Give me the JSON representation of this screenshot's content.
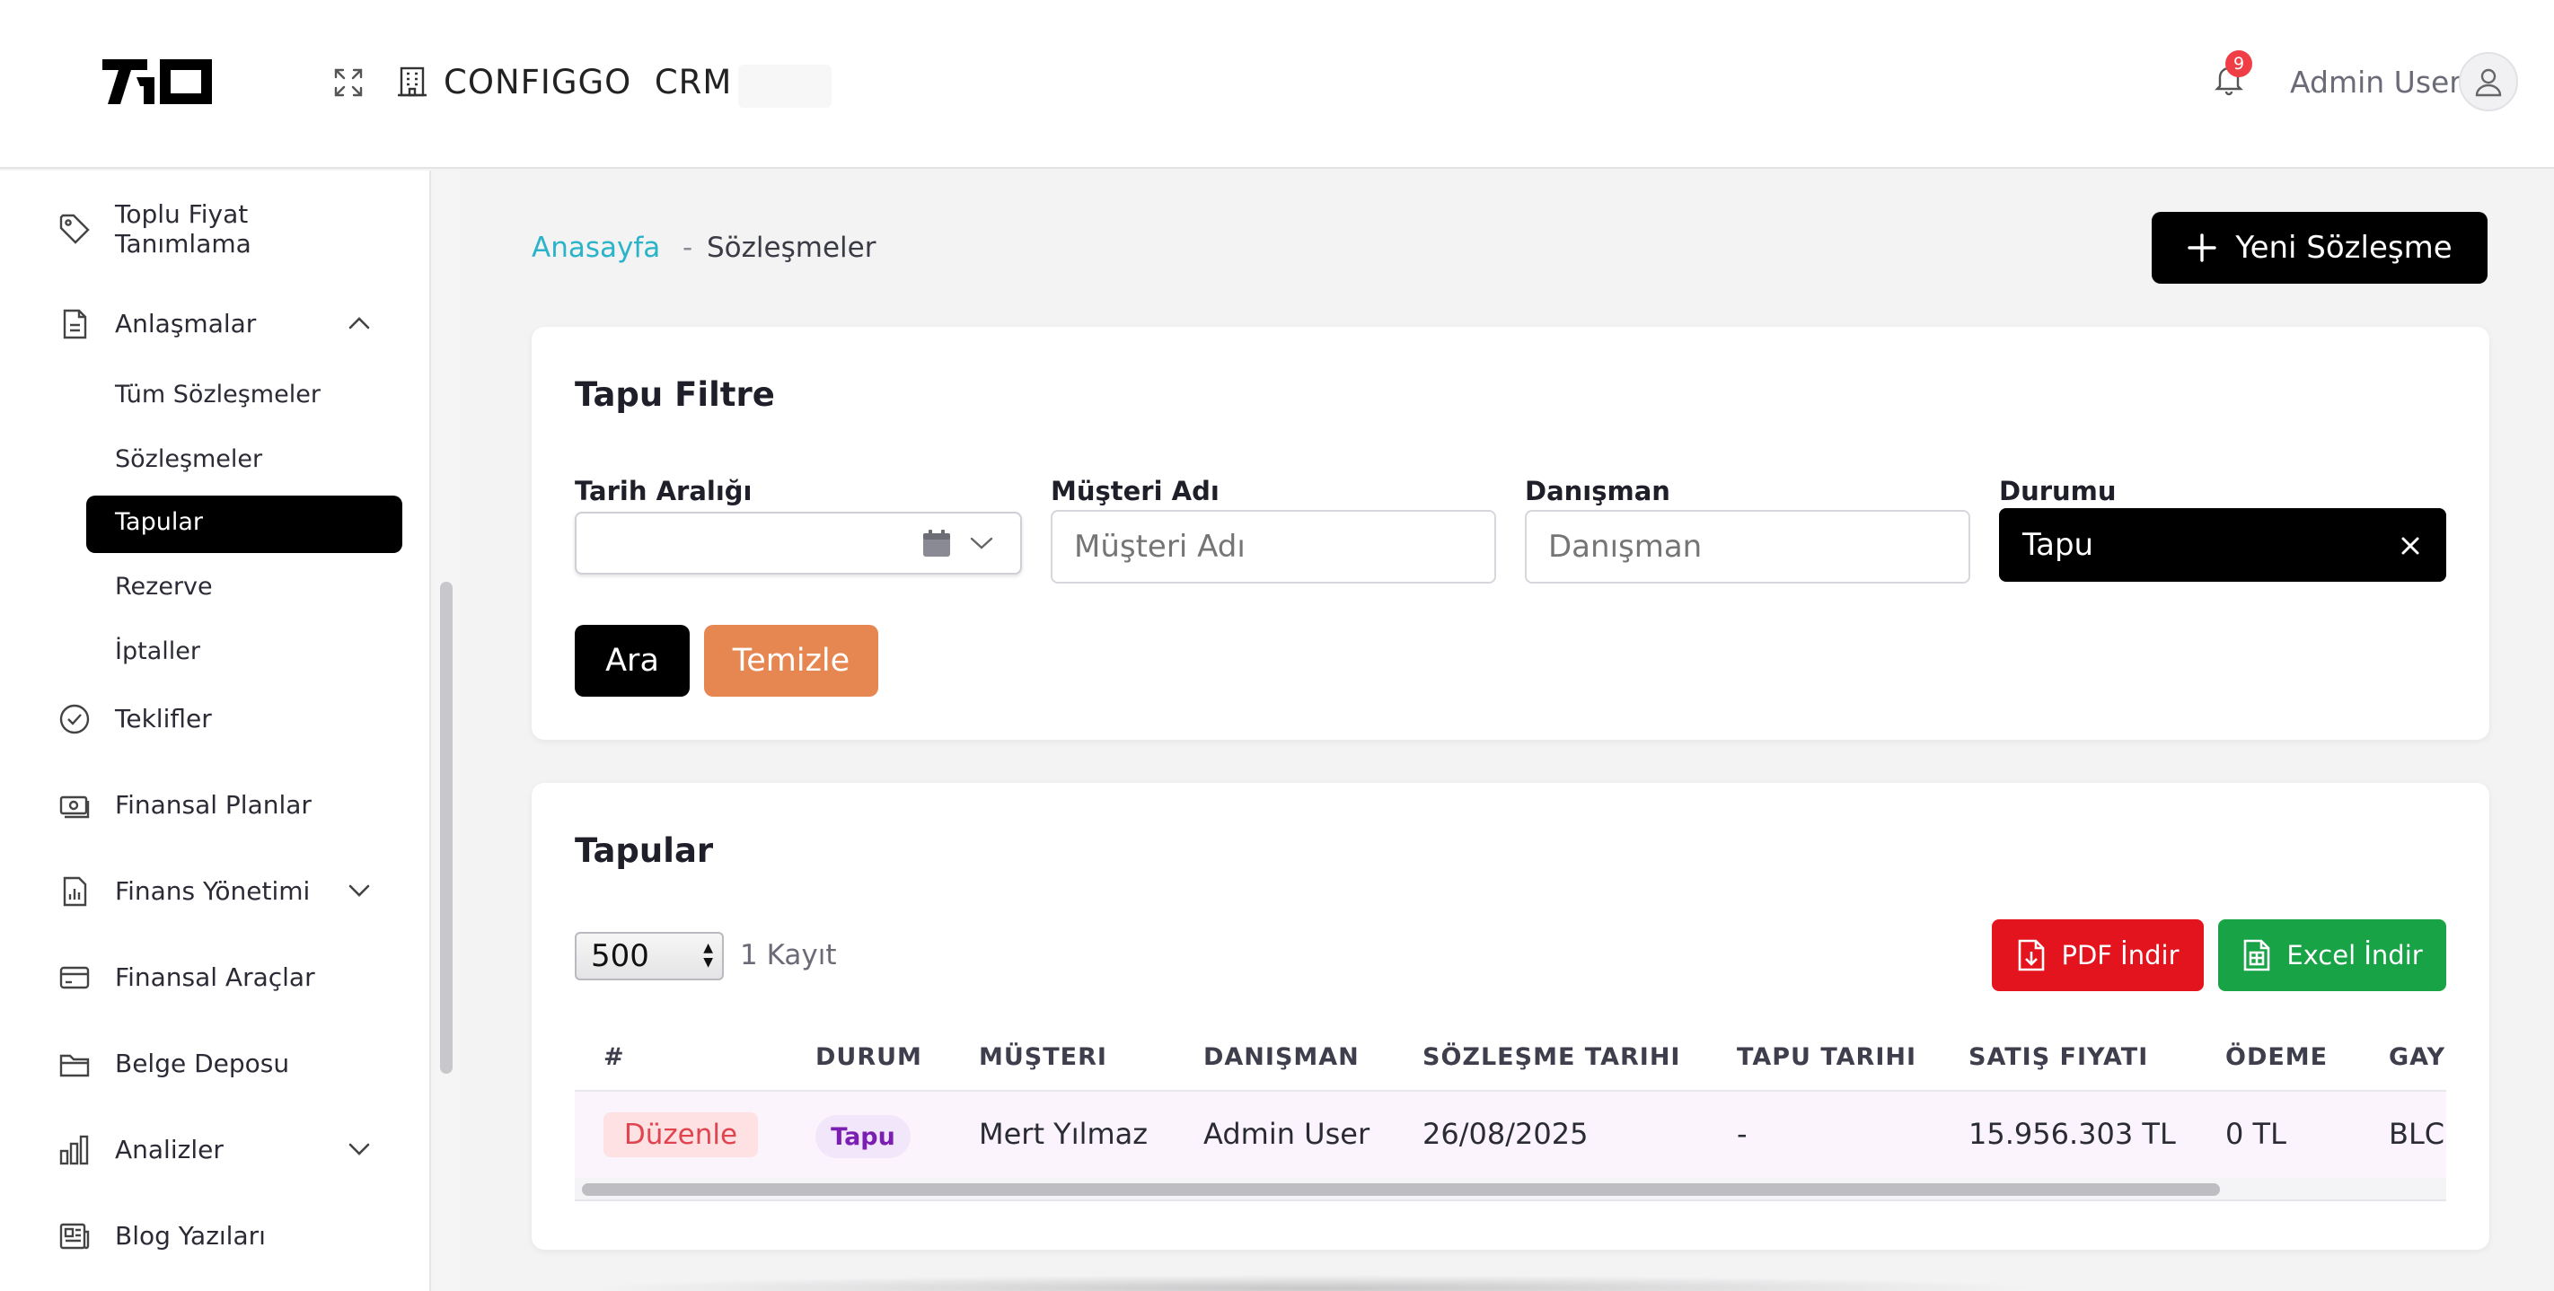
{
  "header": {
    "app_title": "CONFIGGO  CRM",
    "notification_count": "9",
    "user_name": "Admin User"
  },
  "sidebar": {
    "items": [
      {
        "label": "Toplu Fiyat\nTanımlama",
        "icon": "tag-icon"
      },
      {
        "label": "Anlaşmalar",
        "icon": "document-icon",
        "expanded": true
      },
      {
        "label": "Teklifler",
        "icon": "check-circle-icon"
      },
      {
        "label": "Finansal Planlar",
        "icon": "money-icon"
      },
      {
        "label": "Finans Yönetimi",
        "icon": "report-icon",
        "expandable": true
      },
      {
        "label": "Finansal Araçlar",
        "icon": "card-icon"
      },
      {
        "label": "Belge Deposu",
        "icon": "folder-icon"
      },
      {
        "label": "Analizler",
        "icon": "bar-chart-icon",
        "expandable": true
      },
      {
        "label": "Blog Yazıları",
        "icon": "newspaper-icon"
      }
    ],
    "sub_items": [
      {
        "label": "Tüm Sözleşmeler"
      },
      {
        "label": "Sözleşmeler"
      },
      {
        "label": "Tapular",
        "active": true
      },
      {
        "label": "Rezerve"
      },
      {
        "label": "İptaller"
      }
    ]
  },
  "breadcrumb": {
    "home": "Anasayfa",
    "separator": "-",
    "current": "Sözleşmeler"
  },
  "new_button_label": "Yeni Sözleşme",
  "filter": {
    "title": "Tapu Filtre",
    "date_label": "Tarih Aralığı",
    "customer_label": "Müşteri Adı",
    "customer_placeholder": "Müşteri Adı",
    "advisor_label": "Danışman",
    "advisor_placeholder": "Danışman",
    "status_label": "Durumu",
    "status_value": "Tapu",
    "search_button": "Ara",
    "clear_button": "Temizle"
  },
  "table": {
    "title": "Tapular",
    "page_size": "500",
    "record_count": "1 Kayıt",
    "pdf_button": "PDF İndir",
    "excel_button": "Excel İndir",
    "columns": [
      "#",
      "DURUM",
      "MÜŞTERI",
      "DANIŞMAN",
      "SÖZLEŞME TARIHI",
      "TAPU TARIHI",
      "SATIŞ FIYATI",
      "ÖDEME",
      "GAY"
    ],
    "rows": [
      {
        "action": "Düzenle",
        "status": "Tapu",
        "customer": "Mert Yılmaz",
        "advisor": "Admin User",
        "contract_date": "26/08/2025",
        "deed_date": "-",
        "sale_price": "15.956.303 TL",
        "payment": "0 TL",
        "property": "BLC"
      }
    ]
  },
  "colors": {
    "accent_link": "#2ab3c9",
    "primary": "#000000",
    "clear_button": "#e68752",
    "pdf_button": "#e3141e",
    "excel_button": "#17a346",
    "badge_red": "#ef3e45"
  }
}
